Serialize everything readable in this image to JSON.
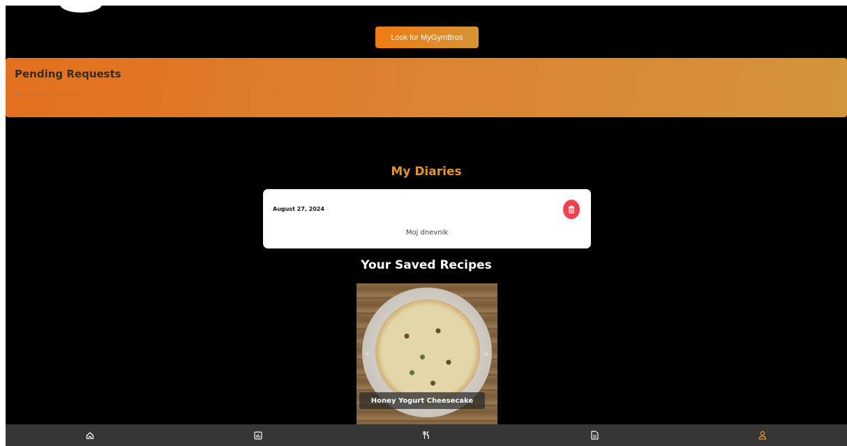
{
  "header": {
    "look_button_label": "Look for MyGymBros"
  },
  "pending": {
    "title": "Pending Requests",
    "empty_text": "No pending requests."
  },
  "diaries": {
    "title": "My Diaries",
    "items": [
      {
        "date": "August 27, 2024",
        "text": "Moj dnevnik"
      }
    ]
  },
  "recipes": {
    "title": "Your Saved Recipes",
    "items": [
      {
        "name": "Honey Yogurt Cheesecake"
      }
    ]
  },
  "bottom_nav": {
    "items": [
      {
        "icon": "home-icon",
        "active": false
      },
      {
        "icon": "stats-icon",
        "active": false
      },
      {
        "icon": "fork-knife-icon",
        "active": false
      },
      {
        "icon": "document-icon",
        "active": false
      },
      {
        "icon": "user-icon",
        "active": true
      }
    ]
  },
  "colors": {
    "accent": "#e2962a",
    "delete": "#f2404e",
    "nav_bg": "#363636",
    "nav_active": "#e8962a"
  }
}
